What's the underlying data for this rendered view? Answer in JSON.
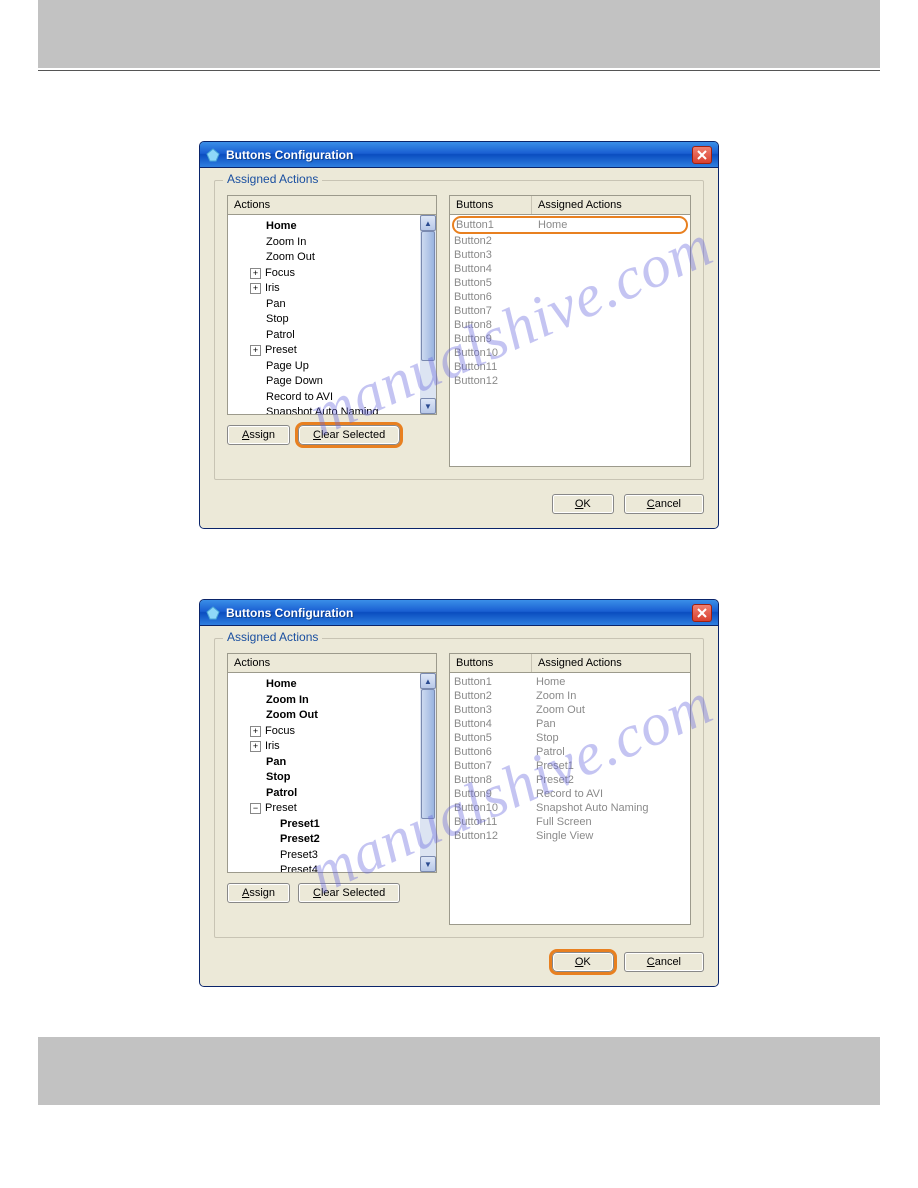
{
  "watermark": "manualshive.com",
  "dialog1": {
    "title": "Buttons Configuration",
    "legend": "Assigned Actions",
    "actions_header": "Actions",
    "buttons_header": "Buttons",
    "assigned_header": "Assigned Actions",
    "tree": [
      {
        "label": "Home",
        "bold": true,
        "expander": ""
      },
      {
        "label": "Zoom In",
        "bold": false,
        "expander": ""
      },
      {
        "label": "Zoom Out",
        "bold": false,
        "expander": ""
      },
      {
        "label": "Focus",
        "bold": false,
        "expander": "+"
      },
      {
        "label": "Iris",
        "bold": false,
        "expander": "+"
      },
      {
        "label": "Pan",
        "bold": false,
        "expander": ""
      },
      {
        "label": "Stop",
        "bold": false,
        "expander": ""
      },
      {
        "label": "Patrol",
        "bold": false,
        "expander": ""
      },
      {
        "label": "Preset",
        "bold": false,
        "expander": "+"
      },
      {
        "label": "Page Up",
        "bold": false,
        "expander": ""
      },
      {
        "label": "Page Down",
        "bold": false,
        "expander": ""
      },
      {
        "label": "Record to AVI",
        "bold": false,
        "expander": ""
      },
      {
        "label": "Snapshot Auto Naming",
        "bold": false,
        "expander": ""
      }
    ],
    "grid": [
      {
        "button": "Button1",
        "action": "Home",
        "highlight": true
      },
      {
        "button": "Button2",
        "action": ""
      },
      {
        "button": "Button3",
        "action": ""
      },
      {
        "button": "Button4",
        "action": ""
      },
      {
        "button": "Button5",
        "action": ""
      },
      {
        "button": "Button6",
        "action": ""
      },
      {
        "button": "Button7",
        "action": ""
      },
      {
        "button": "Button8",
        "action": ""
      },
      {
        "button": "Button9",
        "action": ""
      },
      {
        "button": "Button10",
        "action": ""
      },
      {
        "button": "Button11",
        "action": ""
      },
      {
        "button": "Button12",
        "action": ""
      }
    ],
    "assign_label": "Assign",
    "clear_label": "Clear Selected",
    "clear_highlight": true,
    "ok_label": "OK",
    "ok_highlight": false,
    "cancel_label": "Cancel"
  },
  "dialog2": {
    "title": "Buttons Configuration",
    "legend": "Assigned Actions",
    "actions_header": "Actions",
    "buttons_header": "Buttons",
    "assigned_header": "Assigned Actions",
    "tree": [
      {
        "label": "Home",
        "bold": true,
        "expander": ""
      },
      {
        "label": "Zoom In",
        "bold": true,
        "expander": ""
      },
      {
        "label": "Zoom Out",
        "bold": true,
        "expander": ""
      },
      {
        "label": "Focus",
        "bold": false,
        "expander": "+"
      },
      {
        "label": "Iris",
        "bold": false,
        "expander": "+"
      },
      {
        "label": "Pan",
        "bold": true,
        "expander": ""
      },
      {
        "label": "Stop",
        "bold": true,
        "expander": ""
      },
      {
        "label": "Patrol",
        "bold": true,
        "expander": ""
      },
      {
        "label": "Preset",
        "bold": false,
        "expander": "−"
      },
      {
        "label": "Preset1",
        "bold": true,
        "expander": "",
        "indent": true
      },
      {
        "label": "Preset2",
        "bold": true,
        "expander": "",
        "indent": true
      },
      {
        "label": "Preset3",
        "bold": false,
        "expander": "",
        "indent": true
      },
      {
        "label": "Preset4",
        "bold": false,
        "expander": "",
        "indent": true
      }
    ],
    "grid": [
      {
        "button": "Button1",
        "action": "Home"
      },
      {
        "button": "Button2",
        "action": "Zoom In"
      },
      {
        "button": "Button3",
        "action": "Zoom Out"
      },
      {
        "button": "Button4",
        "action": "Pan"
      },
      {
        "button": "Button5",
        "action": "Stop"
      },
      {
        "button": "Button6",
        "action": "Patrol"
      },
      {
        "button": "Button7",
        "action": "Preset1"
      },
      {
        "button": "Button8",
        "action": "Preset2"
      },
      {
        "button": "Button9",
        "action": "Record to AVI"
      },
      {
        "button": "Button10",
        "action": "Snapshot Auto Naming"
      },
      {
        "button": "Button11",
        "action": "Full Screen"
      },
      {
        "button": "Button12",
        "action": "Single View"
      }
    ],
    "assign_label": "Assign",
    "clear_label": "Clear Selected",
    "clear_highlight": false,
    "ok_label": "OK",
    "ok_highlight": true,
    "cancel_label": "Cancel"
  }
}
